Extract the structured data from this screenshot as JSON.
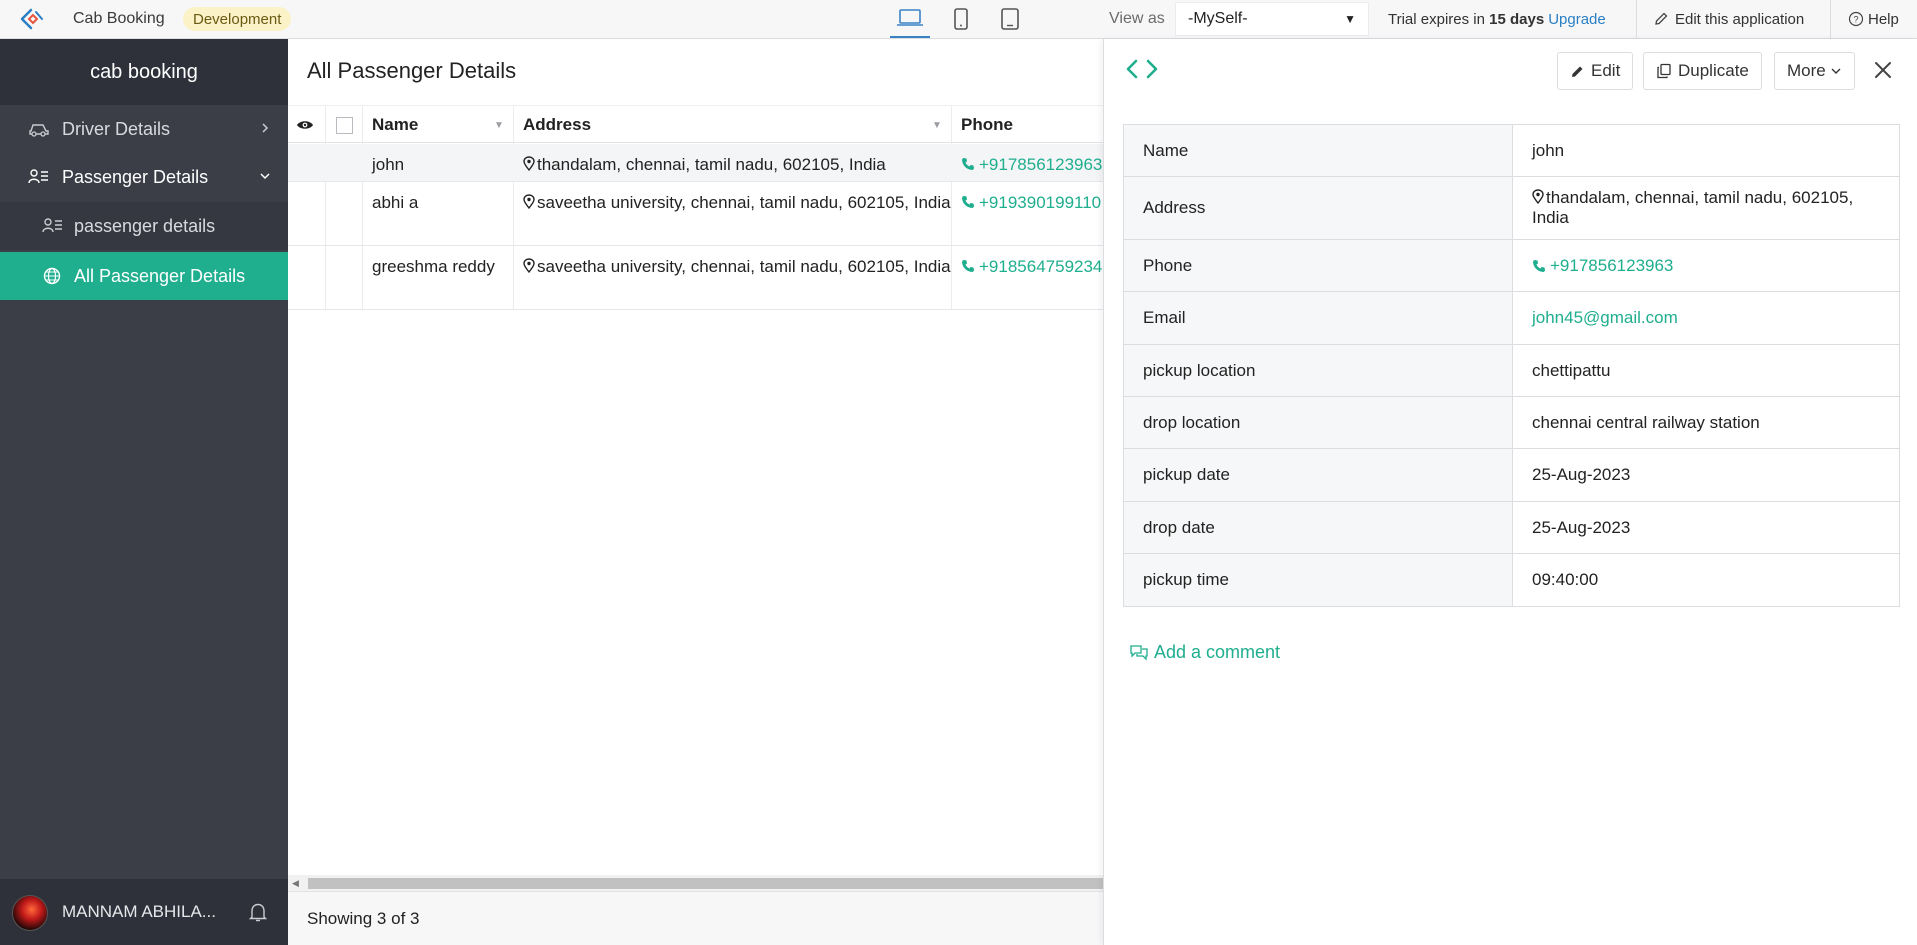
{
  "topbar": {
    "app_name": "Cab Booking",
    "env_badge": "Development",
    "view_as_label": "View as",
    "view_as_value": "-MySelf-",
    "trial_prefix": "Trial expires in",
    "trial_days": "15 days",
    "upgrade_label": "Upgrade",
    "edit_app_label": "Edit this application",
    "help_label": "Help"
  },
  "sidebar": {
    "app_title": "cab booking",
    "items": [
      {
        "label": "Driver Details",
        "icon": "car-icon"
      },
      {
        "label": "Passenger Details",
        "icon": "user-list-icon"
      },
      {
        "label": "passenger details",
        "icon": "user-list-icon"
      },
      {
        "label": "All Passenger Details",
        "icon": "globe-icon"
      }
    ],
    "user_name": "MANNAM ABHILA..."
  },
  "list": {
    "title": "All Passenger Details",
    "columns": [
      "Name",
      "Address",
      "Phone"
    ],
    "rows": [
      {
        "name": "john",
        "address": "thandalam, chennai, tamil nadu, 602105, India",
        "phone": "+917856123963"
      },
      {
        "name": "abhi a",
        "address": "saveetha university, chennai, tamil nadu, 602105, India",
        "phone": "+919390199110"
      },
      {
        "name": "greeshma reddy",
        "address": "saveetha university, chennai, tamil nadu, 602105, India",
        "phone": "+918564759234"
      }
    ],
    "footer": "Showing 3 of 3"
  },
  "detail": {
    "buttons": {
      "edit": "Edit",
      "duplicate": "Duplicate",
      "more": "More"
    },
    "fields": [
      {
        "label": "Name",
        "value": "john"
      },
      {
        "label": "Address",
        "value": "thandalam, chennai, tamil nadu, 602105, India"
      },
      {
        "label": "Phone",
        "value": "+917856123963"
      },
      {
        "label": "Email",
        "value": "john45@gmail.com"
      },
      {
        "label": "pickup location",
        "value": "chettipattu"
      },
      {
        "label": "drop location",
        "value": "chennai central railway station"
      },
      {
        "label": "pickup date",
        "value": "25-Aug-2023"
      },
      {
        "label": "drop date",
        "value": "25-Aug-2023"
      },
      {
        "label": "pickup time",
        "value": "09:40:00"
      }
    ],
    "add_comment": "Add a comment"
  },
  "colors": {
    "accent": "#1fae8e",
    "sidebar": "#3b3e47",
    "link": "#2a7fc4"
  }
}
